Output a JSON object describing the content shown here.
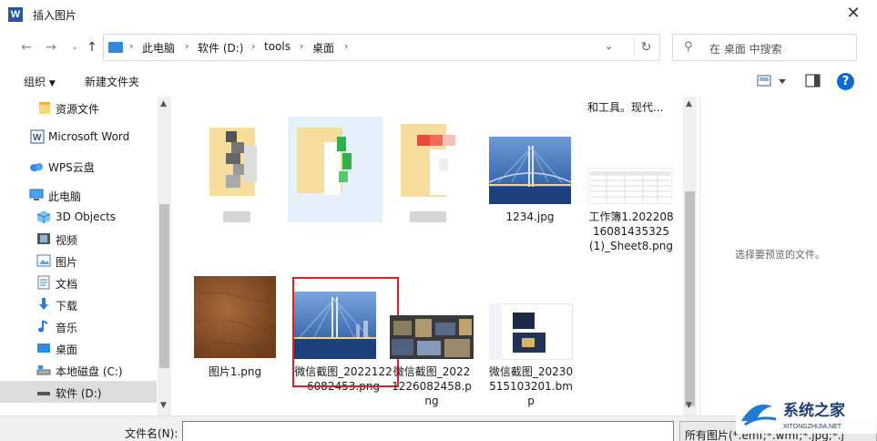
{
  "window": {
    "title": "插入图片",
    "app_icon": "W",
    "close_icon": "close-icon"
  },
  "nav": {
    "crumbs": [
      "此电脑",
      "软件 (D:)",
      "tools",
      "桌面"
    ],
    "search_placeholder": "在 桌面 中搜索"
  },
  "toolbar": {
    "organize": "组织",
    "new_folder": "新建文件夹"
  },
  "sidebar": {
    "items": [
      {
        "label": "资源文件",
        "icon": "folder-icon"
      },
      {
        "label": "Microsoft Word",
        "icon": "word-icon"
      },
      {
        "label": "WPS云盘",
        "icon": "cloud-icon"
      },
      {
        "label": "此电脑",
        "icon": "computer-icon"
      },
      {
        "label": "3D Objects",
        "icon": "cube-icon"
      },
      {
        "label": "视频",
        "icon": "video-icon"
      },
      {
        "label": "图片",
        "icon": "picture-icon"
      },
      {
        "label": "文档",
        "icon": "document-icon"
      },
      {
        "label": "下载",
        "icon": "download-icon"
      },
      {
        "label": "音乐",
        "icon": "music-icon"
      },
      {
        "label": "桌面",
        "icon": "desktop-icon"
      },
      {
        "label": "本地磁盘 (C:)",
        "icon": "drive-icon"
      },
      {
        "label": "软件 (D:)",
        "icon": "drive-icon"
      }
    ]
  },
  "files": {
    "top_text": "和工具。现代...",
    "items": [
      {
        "name": "",
        "kind": "blurred-folder"
      },
      {
        "name": "",
        "kind": "blurred-folder-green"
      },
      {
        "name": "",
        "kind": "blurred-folder-red"
      },
      {
        "name": "1234.jpg",
        "kind": "bridge"
      },
      {
        "name": "工作簿1.20220816081435325(1)_Sheet8.png",
        "kind": "sheet"
      },
      {
        "name": "图片1.png",
        "kind": "leather"
      },
      {
        "name": "微信截图_20221226082453.png",
        "kind": "bridge"
      },
      {
        "name": "微信截图_20221226082458.png",
        "kind": "city"
      },
      {
        "name": "微信截图_20230515103201.bmp",
        "kind": "screenshot"
      }
    ]
  },
  "preview": {
    "message": "选择要预览的文件。"
  },
  "bottom": {
    "filename_label": "文件名(N):",
    "filename_value": "",
    "filetype": "所有图片(*.emf;*.wmf;*.jpg;*.j"
  },
  "watermark": {
    "title": "系统之家",
    "url": "XITONGZHIJIA.NET"
  },
  "colors": {
    "accent": "#0d6ad4",
    "selection_box": "#e02020",
    "selected_bg": "#dcdcdc"
  }
}
